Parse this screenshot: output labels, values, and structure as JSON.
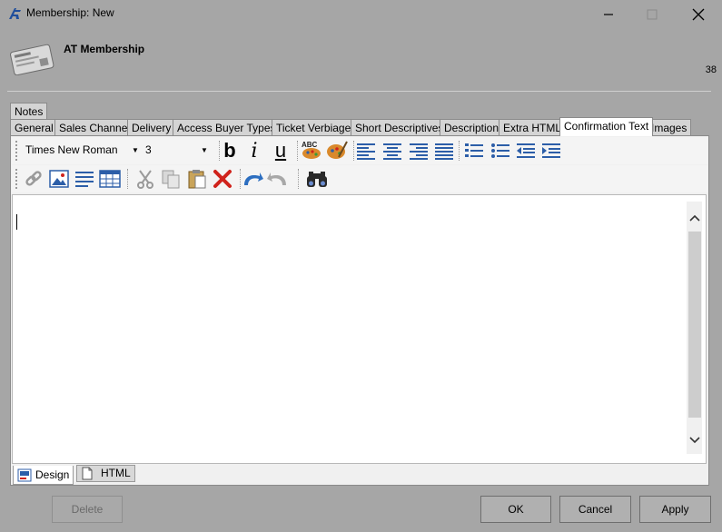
{
  "window": {
    "title": "Membership: New",
    "minimize_icon": "minimize-icon",
    "maximize_icon": "maximize-icon",
    "close_icon": "close-icon"
  },
  "header": {
    "title": "AT Membership",
    "count": "38"
  },
  "tabs": {
    "notes": "Notes",
    "items": [
      {
        "label": "General"
      },
      {
        "label": "Sales Channel"
      },
      {
        "label": "Delivery"
      },
      {
        "label": "Access Buyer Types"
      },
      {
        "label": "Ticket Verbiage"
      },
      {
        "label": "Short Descriptives"
      },
      {
        "label": "Description"
      },
      {
        "label": "Extra HTML"
      },
      {
        "label": "Confirmation Text"
      },
      {
        "label": "Images"
      }
    ],
    "active": "Confirmation Text"
  },
  "toolbar": {
    "font_name": "Times New Roman",
    "font_size": "3",
    "bold": "b",
    "italic": "i",
    "underline": "u",
    "spell_text": "ABC"
  },
  "editor": {
    "content": ""
  },
  "mode_tabs": {
    "design": "Design",
    "html": "HTML"
  },
  "footer": {
    "delete": "Delete",
    "ok": "OK",
    "cancel": "Cancel",
    "apply": "Apply"
  },
  "colors": {
    "window_bg": "#a6a6a6",
    "panel_bg": "#f0f0f0",
    "icon_blue": "#2c5ea8",
    "delete_red": "#d0231c"
  }
}
